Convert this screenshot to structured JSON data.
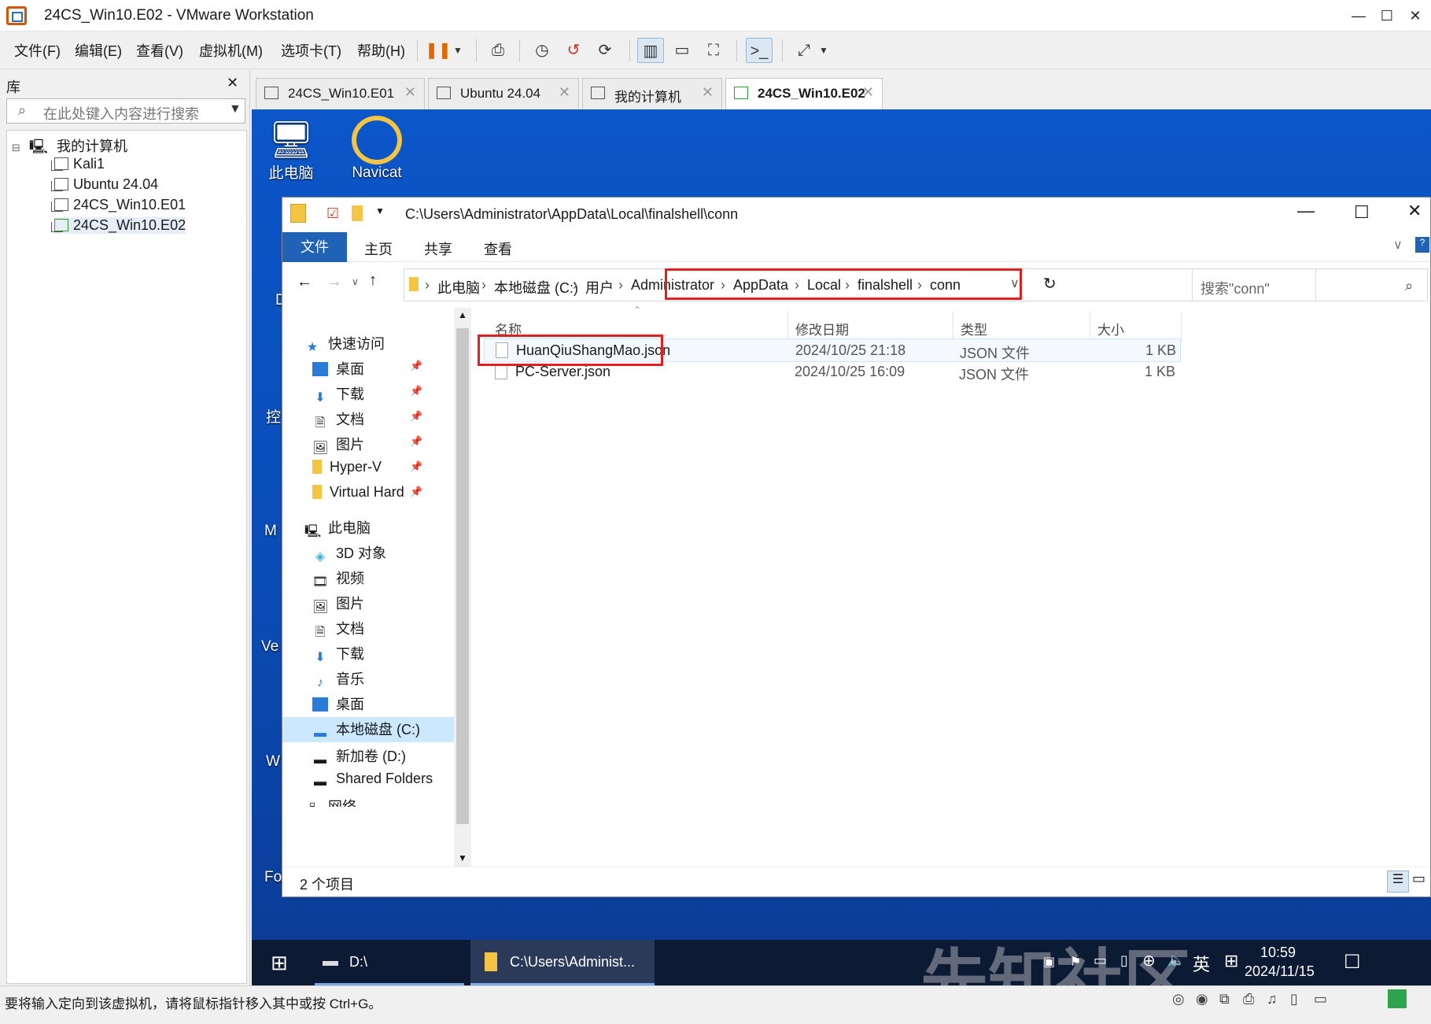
{
  "window": {
    "title": "24CS_Win10.E02 - VMware Workstation"
  },
  "menu": [
    "文件(F)",
    "编辑(E)",
    "查看(V)",
    "虚拟机(M)",
    "选项卡(T)",
    "帮助(H)"
  ],
  "library": {
    "header": "库",
    "search_placeholder": "在此处键入内容进行搜索",
    "root": "我的计算机",
    "vms": [
      "Kali1",
      "Ubuntu 24.04",
      "24CS_Win10.E01",
      "24CS_Win10.E02"
    ]
  },
  "tabs": [
    {
      "label": "24CS_Win10.E01",
      "active": false
    },
    {
      "label": "Ubuntu 24.04",
      "active": false
    },
    {
      "label": "我的计算机",
      "active": false
    },
    {
      "label": "24CS_Win10.E02",
      "active": true
    }
  ],
  "desktop": {
    "icons": [
      {
        "label": "此电脑"
      },
      {
        "label": "Navicat"
      }
    ],
    "partial_labels": [
      "D",
      "控",
      "M",
      "Ve",
      "W",
      "Fo"
    ]
  },
  "explorer": {
    "title_path": "C:\\Users\\Administrator\\AppData\\Local\\finalshell\\conn",
    "ribbon_tabs": [
      "文件",
      "主页",
      "共享",
      "查看"
    ],
    "breadcrumbs": [
      "此电脑",
      "本地磁盘 (C:)",
      "用户",
      "Administrator",
      "AppData",
      "Local",
      "finalshell",
      "conn"
    ],
    "search_placeholder": "搜索\"conn\"",
    "nav": {
      "quick_access": "快速访问",
      "quick_items": [
        "桌面",
        "下载",
        "文档",
        "图片",
        "Hyper-V",
        "Virtual Hard"
      ],
      "this_pc": "此电脑",
      "pc_items": [
        "3D 对象",
        "视频",
        "图片",
        "文档",
        "下载",
        "音乐",
        "桌面",
        "本地磁盘 (C:)",
        "新加卷 (D:)",
        "Shared Folders"
      ],
      "network": "网络"
    },
    "columns": [
      "名称",
      "修改日期",
      "类型",
      "大小"
    ],
    "files": [
      {
        "name": "HuanQiuShangMao.json",
        "date": "2024/10/25 21:18",
        "type": "JSON 文件",
        "size": "1 KB"
      },
      {
        "name": "PC-Server.json",
        "date": "2024/10/25 16:09",
        "type": "JSON 文件",
        "size": "1 KB"
      }
    ],
    "status": "2 个项目"
  },
  "taskbar": {
    "items": [
      "D:\\",
      "C:\\Users\\Administ..."
    ],
    "ime": "英",
    "time": "10:59",
    "date": "2024/11/15"
  },
  "watermark": "先知社区",
  "statusbar": {
    "message": "要将输入定向到该虚拟机，请将鼠标指针移入其中或按 Ctrl+G。"
  },
  "colors": {
    "ribbon_file": "#1f62b6",
    "desktop": "#0b56c9",
    "highlight": "#e02020",
    "taskbar": "#0d1a33"
  }
}
